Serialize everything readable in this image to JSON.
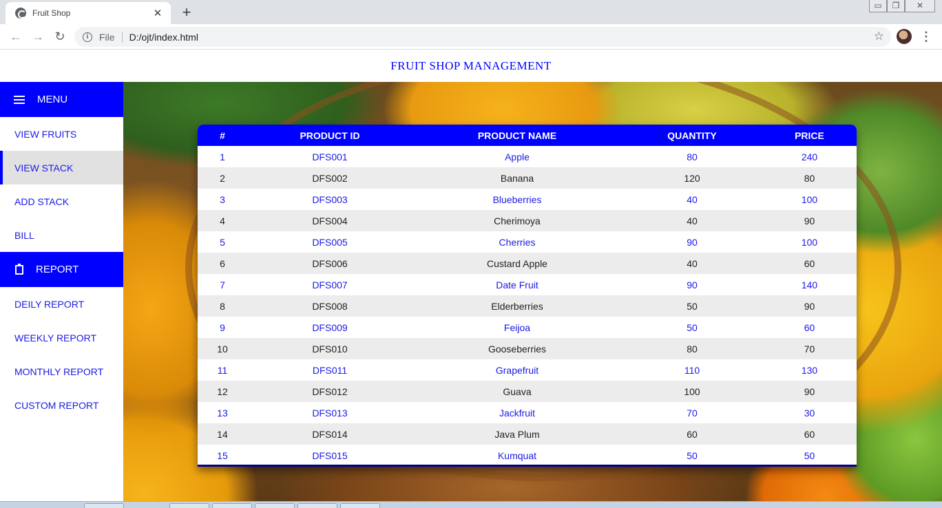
{
  "browser": {
    "tab_title": "Fruit Shop",
    "tab_close": "✕",
    "new_tab": "+",
    "omnibox_scheme": "File",
    "omnibox_url": "D:/ojt/index.html"
  },
  "page": {
    "title": "FRUIT SHOP MANAGEMENT"
  },
  "sidebar": {
    "menu_header": "MENU",
    "menu_items": [
      {
        "label": "VIEW FRUITS"
      },
      {
        "label": "VIEW STACK",
        "active": true
      },
      {
        "label": "ADD STACK"
      },
      {
        "label": "BILL"
      }
    ],
    "report_header": "REPORT",
    "report_items": [
      {
        "label": "DEILY REPORT"
      },
      {
        "label": "WEEKLY REPORT"
      },
      {
        "label": "MONTHLY REPORT"
      },
      {
        "label": "CUSTOM REPORT"
      }
    ]
  },
  "table": {
    "columns": [
      "#",
      "PRODUCT ID",
      "PRODUCT NAME",
      "QUANTITY",
      "PRICE"
    ],
    "rows": [
      [
        "1",
        "DFS001",
        "Apple",
        "80",
        "240"
      ],
      [
        "2",
        "DFS002",
        "Banana",
        "120",
        "80"
      ],
      [
        "3",
        "DFS003",
        "Blueberries",
        "40",
        "100"
      ],
      [
        "4",
        "DFS004",
        "Cherimoya",
        "40",
        "90"
      ],
      [
        "5",
        "DFS005",
        "Cherries",
        "90",
        "100"
      ],
      [
        "6",
        "DFS006",
        "Custard Apple",
        "40",
        "60"
      ],
      [
        "7",
        "DFS007",
        "Date Fruit",
        "90",
        "140"
      ],
      [
        "8",
        "DFS008",
        "Elderberries",
        "50",
        "90"
      ],
      [
        "9",
        "DFS009",
        "Feijoa",
        "50",
        "60"
      ],
      [
        "10",
        "DFS010",
        "Gooseberries",
        "80",
        "70"
      ],
      [
        "11",
        "DFS011",
        "Grapefruit",
        "110",
        "130"
      ],
      [
        "12",
        "DFS012",
        "Guava",
        "100",
        "90"
      ],
      [
        "13",
        "DFS013",
        "Jackfruit",
        "70",
        "30"
      ],
      [
        "14",
        "DFS014",
        "Java Plum",
        "60",
        "60"
      ],
      [
        "15",
        "DFS015",
        "Kumquat",
        "50",
        "50"
      ]
    ]
  },
  "colors": {
    "accent": "#0000ff",
    "row_alt": "#ececec",
    "active_nav": "#e1e1e1"
  },
  "icons": [
    "globe-icon",
    "close-icon",
    "plus-icon",
    "back-icon",
    "forward-icon",
    "reload-icon",
    "info-icon",
    "star-icon",
    "avatar",
    "kebab-menu-icon",
    "hamburger-icon",
    "clipboard-icon"
  ]
}
